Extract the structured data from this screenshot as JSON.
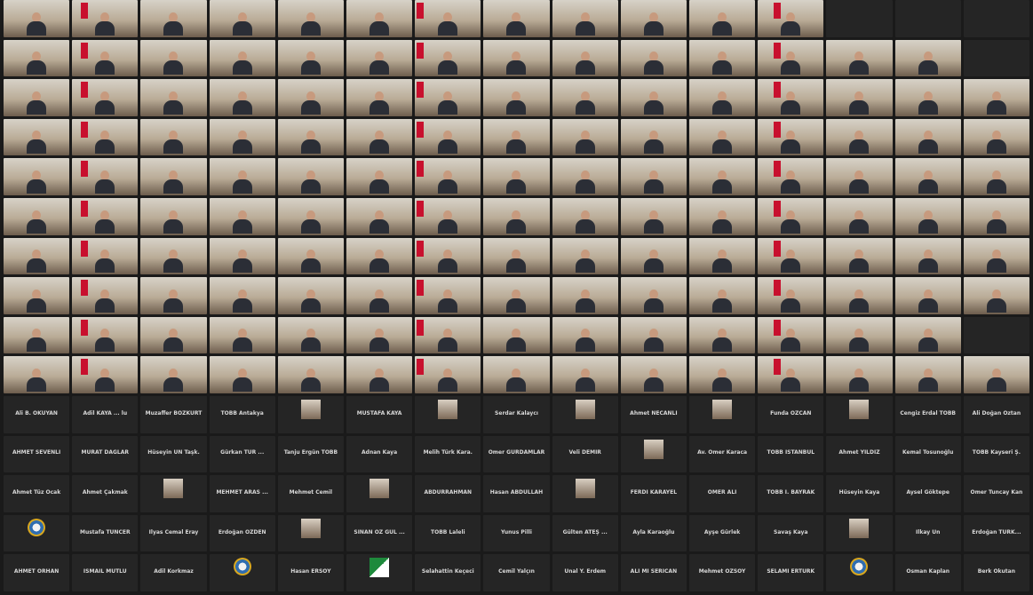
{
  "meeting": {
    "layout": "gallery-view",
    "participants_visible": 225,
    "video_tile_count": 150,
    "label_tile_count": 75,
    "participant_labels": [
      "Ali B. OKUYAN",
      "Adil KAYA ... lu",
      "Muzaffer BOZKURT",
      "TOBB Antakya",
      "",
      "MUSTAFA KAYA",
      "",
      "Serdar Kalaycı",
      "",
      "Ahmet NECANLI",
      "",
      "Funda ÖZCAN",
      "",
      "Cengiz Erdal TOBB",
      "Ali Doğan Öztan",
      "AHMET SEVENLİ",
      "MURAT DAĞLAR",
      "Hüseyin ÜN Taşk.",
      "Gürkan TÜR ...",
      "Tanju Ergün TOBB",
      "Adnan Kaya",
      "Melih Türk Kara.",
      "Ömer GÜRDAMLAR",
      "Veli DEMİR",
      "",
      "Av. Ömer Karaca",
      "TOBB İSTANBUL",
      "Ahmet YILDIZ",
      "Kemal Tosunoğlu",
      "TOBB Kayseri Ş.",
      "Ahmet Tüz Ocak",
      "Ahmet Çakmak",
      "",
      "MEHMET ARAS ...",
      "Mehmet Cemil",
      "",
      "ABDURRAHMAN",
      "Hasan ABDULLAH",
      "",
      "FERDİ KARAYEL",
      "ÖMER ALİ",
      "TOBB İ. BAYRAK",
      "Hüseyin Kaya",
      "Aysel Göktepe",
      "Ömer Tuncay Kan",
      "",
      "Mustafa TUNCER",
      "İlyas Cemal Eray",
      "Erdoğan ÖZDEN",
      "",
      "SİNAN ÖZ GÜL ...",
      "TOBB Laleli",
      "Yunus Pilli",
      "Gülten ATEŞ ...",
      "Ayla Karaoğlu",
      "Ayşe Gürlek",
      "Savaş Kaya",
      "",
      "İlkay Ün",
      "Erdoğan TÜRK...",
      "AHMET ORHAN",
      "İSMAİL MUTLU",
      "Adil Korkmaz",
      "",
      "Hasan ERSOY",
      "",
      "Selahattin Keçeci",
      "Cemil Yalçın",
      "Ünal Y. Erdem",
      "ALİ Mİ SERİCAN",
      "Mehmet ÖZSOY",
      "SELAMİ ERTÜRK",
      "",
      "Osman Kaplan",
      "Berk Okutan"
    ]
  }
}
